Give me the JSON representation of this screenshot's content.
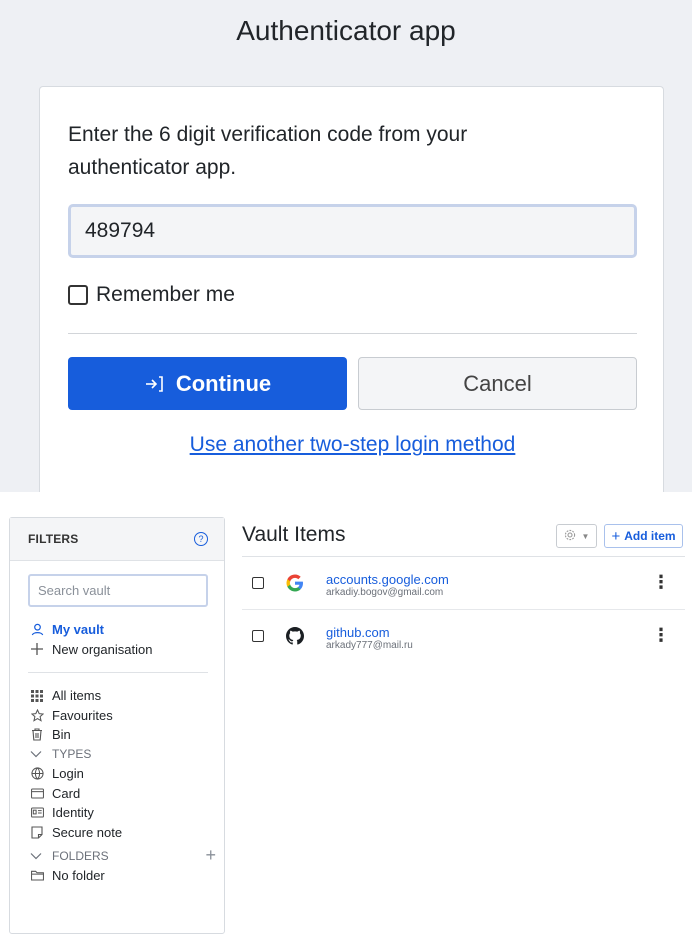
{
  "auth": {
    "title": "Authenticator app",
    "instructions": "Enter the 6 digit verification code from your authenticator app.",
    "code_value": "489794",
    "remember_label": "Remember me",
    "continue_label": "Continue",
    "cancel_label": "Cancel",
    "alt_method_link": "Use another two-step login method",
    "colors": {
      "primary": "#175ddc",
      "background": "#eef0f4"
    }
  },
  "filters": {
    "title": "FILTERS",
    "search_placeholder": "Search vault",
    "my_vault": "My vault",
    "new_org": "New organisation",
    "all_items": "All items",
    "favourites": "Favourites",
    "bin": "Bin",
    "types_header": "TYPES",
    "types": [
      "Login",
      "Card",
      "Identity",
      "Secure note"
    ],
    "folders_header": "FOLDERS",
    "no_folder": "No folder"
  },
  "vault": {
    "title": "Vault Items",
    "add_item": "Add item",
    "items": [
      {
        "name": "accounts.google.com",
        "username": "arkadiy.bogov@gmail.com",
        "icon": "google-logo"
      },
      {
        "name": "github.com",
        "username": "arkady777@mail.ru",
        "icon": "github-logo"
      }
    ]
  }
}
